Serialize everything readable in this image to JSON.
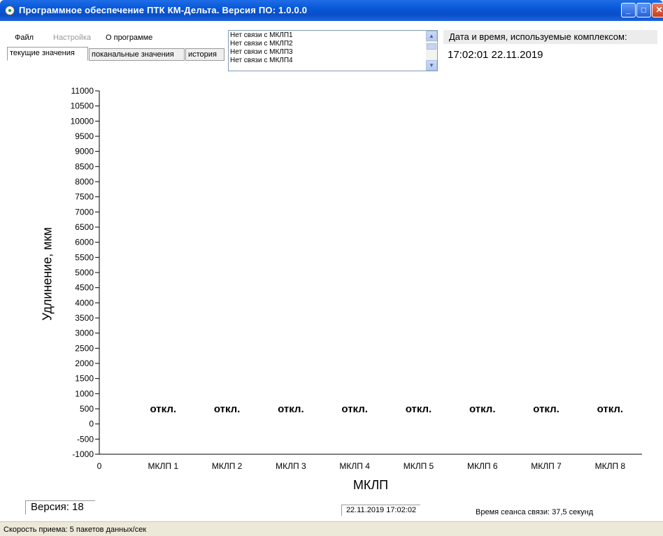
{
  "window": {
    "title": "Программное обеспечение ПТК КМ-Дельта. Версия ПО: 1.0.0.0"
  },
  "menu": {
    "file": "Файл",
    "settings": "Настройка",
    "about": "О программе"
  },
  "tabs": [
    "текущие значения",
    "поканальные значения",
    "история"
  ],
  "status_list": [
    "Нет связи с МКЛП1",
    "Нет связи с МКЛП2",
    "Нет связи с МКЛП3",
    "Нет связи с МКЛП4"
  ],
  "datetime": {
    "label": "Дата и время, используемые комплексом:",
    "value": "17:02:01 22.11.2019"
  },
  "chart_data": {
    "type": "bar",
    "ylabel": "Удлинение, мкм",
    "xlabel": "МКЛП",
    "ylim": [
      -1000,
      11000
    ],
    "yticks": [
      "11000",
      "10500",
      "10000",
      "9500",
      "9000",
      "8500",
      "8000",
      "7500",
      "7000",
      "6500",
      "6000",
      "5500",
      "5000",
      "4500",
      "4000",
      "3500",
      "3000",
      "2500",
      "2000",
      "1500",
      "1000",
      "500",
      "0",
      "-500",
      "-1000"
    ],
    "x_origin_label": "0",
    "categories": [
      "МКЛП 1",
      "МКЛП 2",
      "МКЛП 3",
      "МКЛП 4",
      "МКЛП 5",
      "МКЛП 6",
      "МКЛП 7",
      "МКЛП 8"
    ],
    "bar_labels": [
      "откл.",
      "откл.",
      "откл.",
      "откл.",
      "откл.",
      "откл.",
      "откл.",
      "откл."
    ]
  },
  "footer": {
    "version": "Версия: 18",
    "timestamp": "22.11.2019 17:02:02",
    "session": "Время сеанса связи: 37,5 секунд"
  },
  "statusbar": {
    "text": "Скорость приема:  5  пакетов данных/сек"
  }
}
